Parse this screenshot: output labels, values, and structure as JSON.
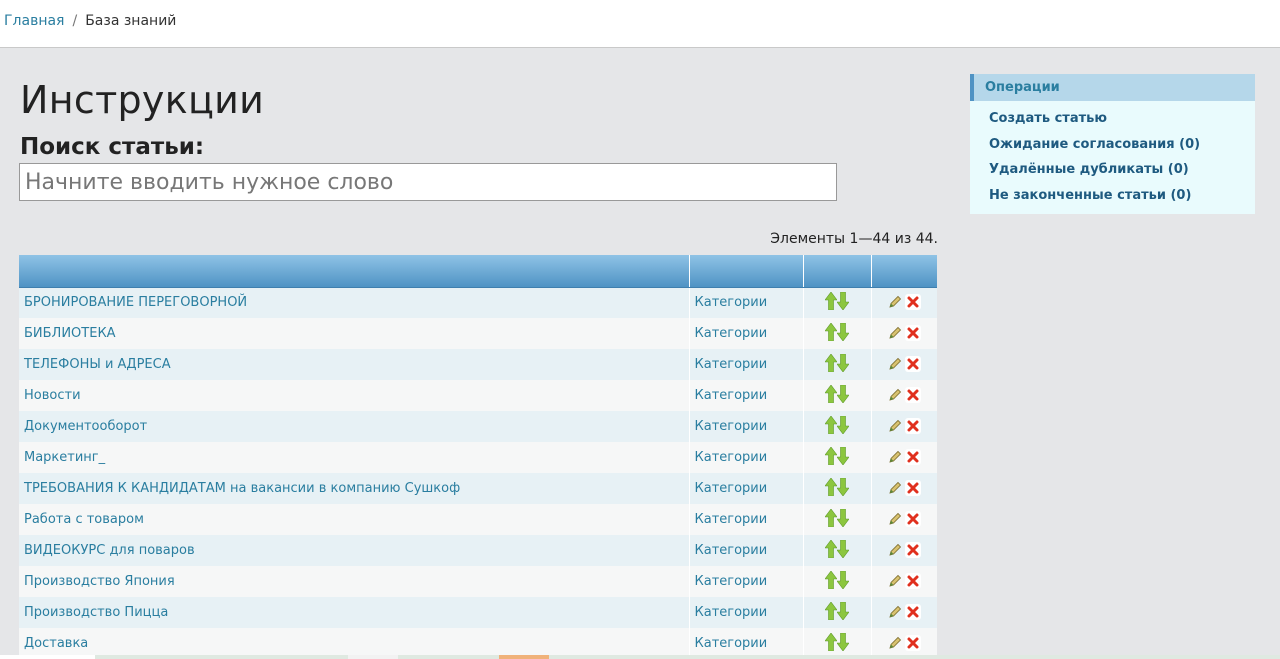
{
  "breadcrumb": {
    "home": "Главная",
    "separator": "/",
    "current": "База знаний"
  },
  "page_title": "Инструкции",
  "search": {
    "label": "Поиск статьи:",
    "placeholder": "Начните вводить нужное слово",
    "value": ""
  },
  "pager": {
    "text": "Элементы 1—44 из 44."
  },
  "table": {
    "headers": [
      "",
      "",
      "",
      ""
    ],
    "rows": [
      {
        "title": "БРОНИРОВАНИЕ ПЕРЕГОВОРНОЙ",
        "category": "Категории"
      },
      {
        "title": "БИБЛИОТЕКА",
        "category": "Категории"
      },
      {
        "title": "ТЕЛЕФОНЫ и АДРЕСА",
        "category": "Категории"
      },
      {
        "title": "Новости",
        "category": "Категории"
      },
      {
        "title": "Документооборот",
        "category": "Категории"
      },
      {
        "title": "Маркетинг_",
        "category": "Категории"
      },
      {
        "title": "ТРЕБОВАНИЯ К КАНДИДАТАМ на вакансии в компанию Сушкоф",
        "category": "Категории"
      },
      {
        "title": "Работа с товаром",
        "category": "Категории"
      },
      {
        "title": "ВИДЕОКУРС для поваров",
        "category": "Категории"
      },
      {
        "title": "Производство Япония",
        "category": "Категории"
      },
      {
        "title": "Производство Пицца",
        "category": "Категории"
      },
      {
        "title": "Доставка",
        "category": "Категории"
      }
    ]
  },
  "icons": {
    "move_up": "arrow-up-icon",
    "move_down": "arrow-down-icon",
    "edit": "pencil-icon",
    "delete": "delete-icon"
  },
  "sidebar": {
    "header": "Операции",
    "items": [
      {
        "label": "Создать статью"
      },
      {
        "label": "Ожидание согласования (0)"
      },
      {
        "label": "Удалённые дубликаты (0)"
      },
      {
        "label": "Не законченные статьи (0)"
      }
    ]
  },
  "colors": {
    "link": "#2a7ea0",
    "arrow": "#8cc63f",
    "delete": "#e0301e",
    "table_header": "#4f93c4",
    "sidebar_bg": "#e9fbfd"
  }
}
